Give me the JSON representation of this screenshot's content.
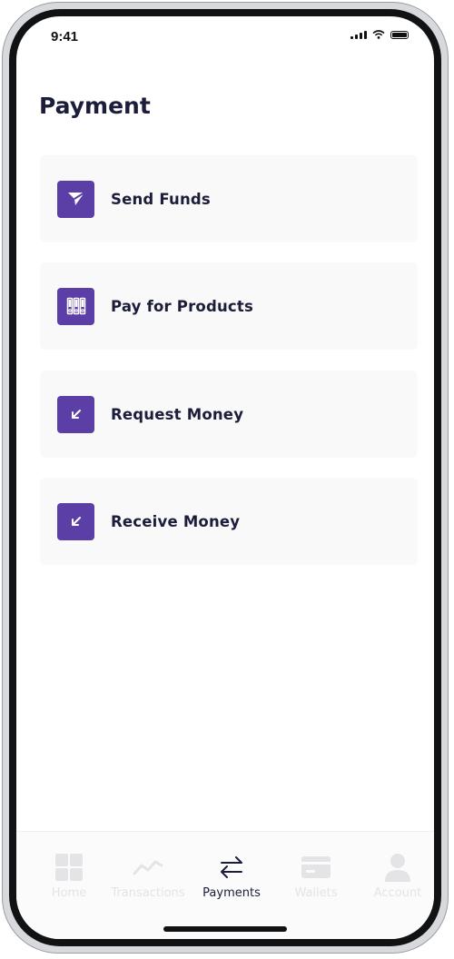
{
  "status_bar": {
    "time": "9:41"
  },
  "page": {
    "title": "Payment"
  },
  "options": [
    {
      "label": "Send Funds",
      "icon": "paper-plane-icon"
    },
    {
      "label": "Pay for Products",
      "icon": "products-icon"
    },
    {
      "label": "Request Money",
      "icon": "arrow-down-left-icon"
    },
    {
      "label": "Receive Money",
      "icon": "arrow-down-left-icon"
    }
  ],
  "tabs": [
    {
      "label": "Home",
      "icon": "grid-icon",
      "active": false
    },
    {
      "label": "Transactions",
      "icon": "trend-icon",
      "active": false
    },
    {
      "label": "Payments",
      "icon": "swap-arrows-icon",
      "active": true
    },
    {
      "label": "Wallets",
      "icon": "card-icon",
      "active": false
    },
    {
      "label": "Account",
      "icon": "user-icon",
      "active": false
    }
  ],
  "colors": {
    "accent": "#5b3fa7",
    "text": "#1b1d3a",
    "inactive": "#e4e4e6",
    "card_bg": "#f9f9f9"
  }
}
